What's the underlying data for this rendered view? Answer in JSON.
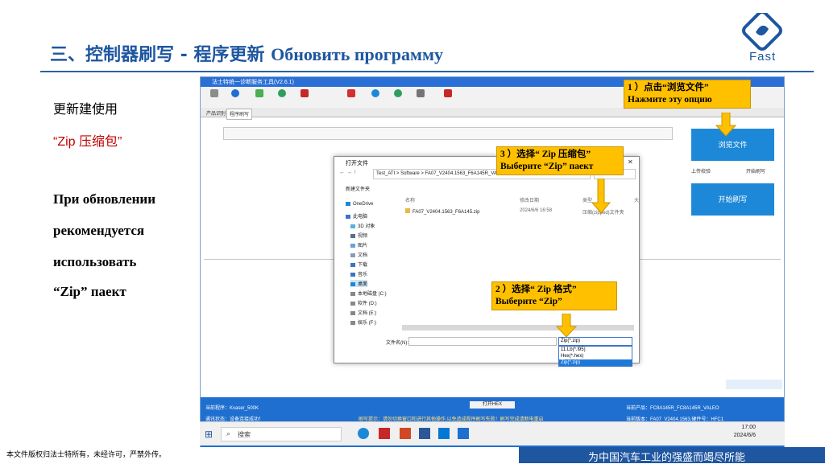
{
  "slide": {
    "title_cn": "三、控制器刷写 -  程序更新",
    "title_ru": "Обновить программу",
    "logo_text": "Fast",
    "left_lines": [
      "更新建使用",
      "“Zip 压缩包”",
      "При обновлении",
      "рекомендуется",
      "использовать",
      "“Zip” паект"
    ],
    "footer_left": "本文件版权归法士特所有，未经许可，严禁外传。",
    "footer_right": "为中国汽车工业的强盛而竭尽所能"
  },
  "app": {
    "title": "法士特统一诊断服务工具(V2.6.1)",
    "tabs": [
      "产品识别",
      "程序刷写"
    ],
    "browse_button": "浏览文件",
    "hex_button": "开始刷写",
    "checkbox_labels": [
      "上传校验",
      "开始刷写"
    ],
    "status_left": [
      "当前程序：Kvaser_500K",
      "通讯状态：设备连接成功！"
    ],
    "status_right": [
      "当前产品：FC8A145R_FC8A145R_VALEO",
      "当前版本：FA07_V2404.1563,硬件号：HFC1"
    ],
    "center_button": "打开HEX",
    "ticker": "刷写提示：请勿切换窗口和进行其他操作,以免造成程序刷写失败！刷写完成请断电重启"
  },
  "dialog": {
    "title": "打开文件",
    "address": "Test_ATI > Software > FA07_V2404.1563_F6A145R_VA...",
    "new_folder": "新建文件夹",
    "nav_items": [
      "OneDrive",
      "此电脑",
      "3D 对象",
      "视频",
      "图片",
      "文档",
      "下载",
      "音乐",
      "桌面",
      "本地磁盘 (C:)",
      "软件 (D:)",
      "文档 (E:)",
      "娱乐 (F:)"
    ],
    "columns": [
      "名称",
      "修改日期",
      "类型",
      "大"
    ],
    "file_name": "FA07_V2404.1563_F6A145.zip",
    "file_date": "2024/6/6 16:58",
    "file_type": "压缩(zipped)文件夹",
    "filename_label": "文件名(N):",
    "filetype_value": "Zip(*.zip)",
    "filetype_options": [
      "11.Lb(*.l95)",
      "Hex(*.hex)",
      "Zip(*.zip)"
    ]
  },
  "callouts": {
    "c1_line1": "1 ）点击“浏览文件”",
    "c1_line2": "Нажмите эту опцию",
    "c2_line1": "2 ）选择“ Zip 格式”",
    "c2_line2": "Выберите “Zip”",
    "c3_line1": "3 ）选择“ Zip 压缩包”",
    "c3_line2": "Выберите “Zip” паект"
  },
  "taskbar": {
    "search": "搜索",
    "time": "17:00",
    "date": "2024/6/6"
  },
  "colors": {
    "brand_blue": "#1e56a0",
    "callout_yellow": "#ffc000",
    "app_blue": "#1f6fd0"
  }
}
